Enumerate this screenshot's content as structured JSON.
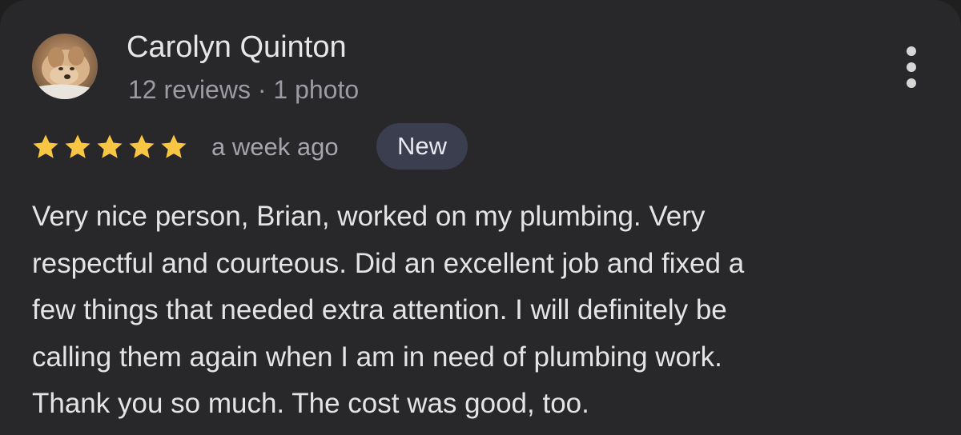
{
  "reviewer": {
    "name": "Carolyn Quinton",
    "meta": "12 reviews · 1 photo",
    "avatar_icon": "dog-photo-avatar"
  },
  "rating": {
    "stars": 5,
    "max": 5,
    "star_color": "#f7c744"
  },
  "time_ago": "a week ago",
  "badge": "New",
  "review_lines": [
    "Very nice person, Brian, worked on my plumbing. Very",
    "respectful and courteous. Did an excellent job and fixed a",
    "few things that needed extra attention. I will definitely be",
    "calling them again when I am in need of plumbing work.",
    "Thank you so much. The cost was good, too."
  ],
  "more_menu_icon": "more-vert-icon",
  "colors": {
    "card_background": "#28282a",
    "badge_background": "#3b3e4f"
  }
}
